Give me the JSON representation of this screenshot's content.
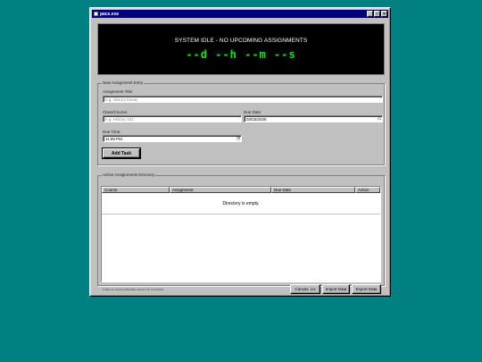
{
  "window": {
    "title": "pace.exe",
    "buttons": [
      "_",
      "□",
      "×"
    ]
  },
  "display": {
    "status": "SYSTEM IDLE - NO UPCOMING ASSIGNMENTS",
    "countdown": "--d --h --m --s"
  },
  "entry": {
    "legend": "New Assignment Entry",
    "title_label": "Assignment Title:",
    "title_placeholder": "e.g. History Essay",
    "course_label": "Class/Course:",
    "course_placeholder": "e.g. History 101",
    "date_label": "Due Date:",
    "date_value": "03/15/2026",
    "time_label": "Due Time:",
    "time_value": "11:59 PM",
    "add_button": "Add Task"
  },
  "directory": {
    "legend": "Active Assignments Directory",
    "columns": [
      "Course",
      "Assignment",
      "Due Date",
      "Action"
    ],
    "empty_message": "Directory is empty."
  },
  "footer": {
    "note": "Data is automatically saved to browser.",
    "buttons": [
      "Canvas .ics",
      "Import Data",
      "Export Data"
    ]
  },
  "colors": {
    "desktop": "#008080",
    "titlebar": "#000080",
    "countdown": "#00ee00"
  }
}
